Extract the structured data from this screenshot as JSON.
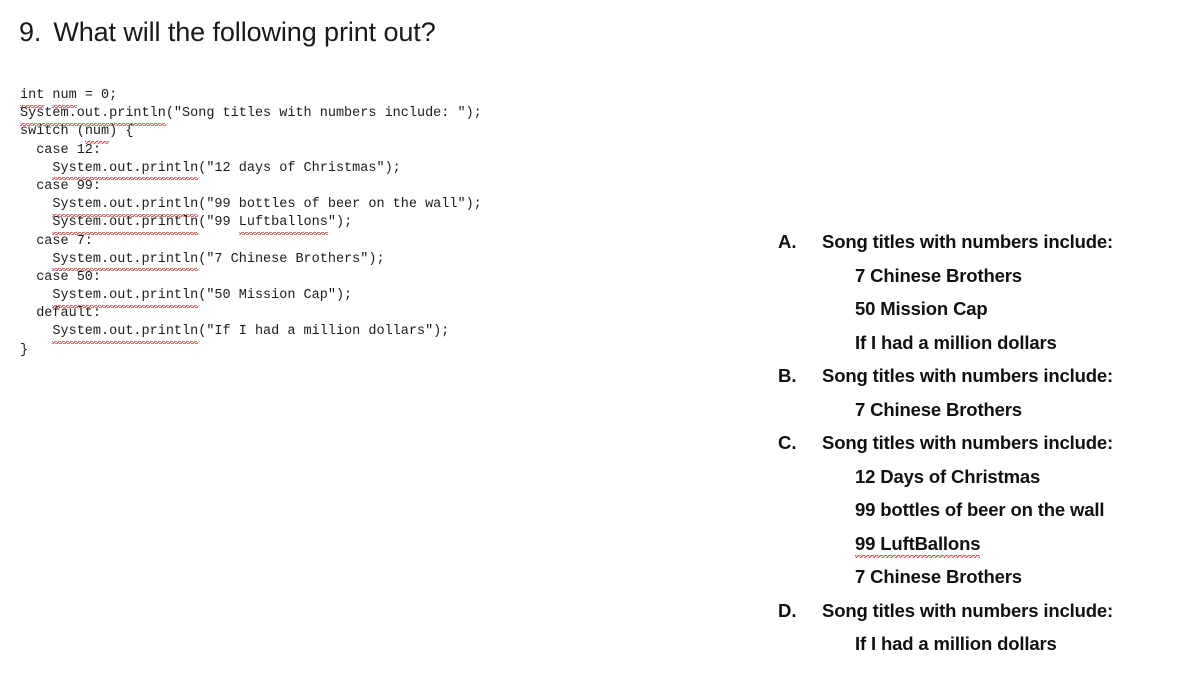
{
  "question": {
    "number": "9.",
    "text": "What will the following print out?"
  },
  "code": {
    "language": "java",
    "lines": [
      {
        "indent": 0,
        "segments": [
          {
            "text": "int",
            "squiggle": true
          },
          {
            "text": " ",
            "squiggle": false
          },
          {
            "text": "num",
            "squiggle": true
          },
          {
            "text": " = 0;",
            "squiggle": false
          }
        ]
      },
      {
        "indent": 0,
        "segments": [
          {
            "text": "System.out.println",
            "squiggle": true
          },
          {
            "text": "(\"Song titles with numbers include: \");",
            "squiggle": false
          }
        ]
      },
      {
        "indent": 0,
        "segments": [
          {
            "text": "switch (",
            "squiggle": false
          },
          {
            "text": "num",
            "squiggle": true
          },
          {
            "text": ") {",
            "squiggle": false
          }
        ]
      },
      {
        "indent": 2,
        "segments": [
          {
            "text": "case 12:",
            "squiggle": false
          }
        ]
      },
      {
        "indent": 4,
        "segments": [
          {
            "text": "System.out.println",
            "squiggle": true
          },
          {
            "text": "(\"12 days of Christmas\");",
            "squiggle": false
          }
        ]
      },
      {
        "indent": 2,
        "segments": [
          {
            "text": "case 99:",
            "squiggle": false
          }
        ]
      },
      {
        "indent": 4,
        "segments": [
          {
            "text": "System.out.println",
            "squiggle": true
          },
          {
            "text": "(\"99 bottles of beer on the wall\");",
            "squiggle": false
          }
        ]
      },
      {
        "indent": 4,
        "segments": [
          {
            "text": "System.out.println",
            "squiggle": true
          },
          {
            "text": "(\"99 ",
            "squiggle": false
          },
          {
            "text": "Luftballons",
            "squiggle": true
          },
          {
            "text": "\");",
            "squiggle": false
          }
        ]
      },
      {
        "indent": 2,
        "segments": [
          {
            "text": "case 7:",
            "squiggle": false
          }
        ]
      },
      {
        "indent": 4,
        "segments": [
          {
            "text": "System.out.println",
            "squiggle": true
          },
          {
            "text": "(\"7 Chinese Brothers\");",
            "squiggle": false
          }
        ]
      },
      {
        "indent": 2,
        "segments": [
          {
            "text": "case 50:",
            "squiggle": false
          }
        ]
      },
      {
        "indent": 4,
        "segments": [
          {
            "text": "System.out.println",
            "squiggle": true
          },
          {
            "text": "(\"50 Mission Cap\");",
            "squiggle": false
          }
        ]
      },
      {
        "indent": 2,
        "segments": [
          {
            "text": "default:",
            "squiggle": false
          }
        ]
      },
      {
        "indent": 4,
        "segments": [
          {
            "text": "System.out.println",
            "squiggle": true
          },
          {
            "text": "(\"If I had a million dollars\");",
            "squiggle": false
          }
        ]
      },
      {
        "indent": 0,
        "segments": [
          {
            "text": "}",
            "squiggle": false
          }
        ]
      }
    ]
  },
  "answers": [
    {
      "letter": "A.",
      "first_line": "Song titles with numbers include:",
      "sub_lines": [
        {
          "text": "7 Chinese Brothers",
          "squiggle": false
        },
        {
          "text": "50 Mission Cap",
          "squiggle": false
        },
        {
          "text": "If I had a million dollars",
          "squiggle": false
        }
      ]
    },
    {
      "letter": "B.",
      "first_line": "Song titles with numbers include:",
      "sub_lines": [
        {
          "text": "7 Chinese Brothers",
          "squiggle": false
        }
      ]
    },
    {
      "letter": "C.",
      "first_line": "Song titles with numbers include:",
      "sub_lines": [
        {
          "text": "12 Days of Christmas",
          "squiggle": false
        },
        {
          "text": "99 bottles of beer on the wall",
          "squiggle": false
        },
        {
          "text": "99 LuftBallons",
          "squiggle": true
        },
        {
          "text": "7 Chinese Brothers",
          "squiggle": false
        }
      ]
    },
    {
      "letter": "D.",
      "first_line": "Song titles with numbers include:",
      "sub_lines": [
        {
          "text": "If I had a million dollars",
          "squiggle": false
        }
      ]
    }
  ],
  "colors": {
    "background": "#ffffff",
    "text": "#111111",
    "code_text": "#1c1c1c",
    "spellcheck_underline": "#c33b3b"
  }
}
